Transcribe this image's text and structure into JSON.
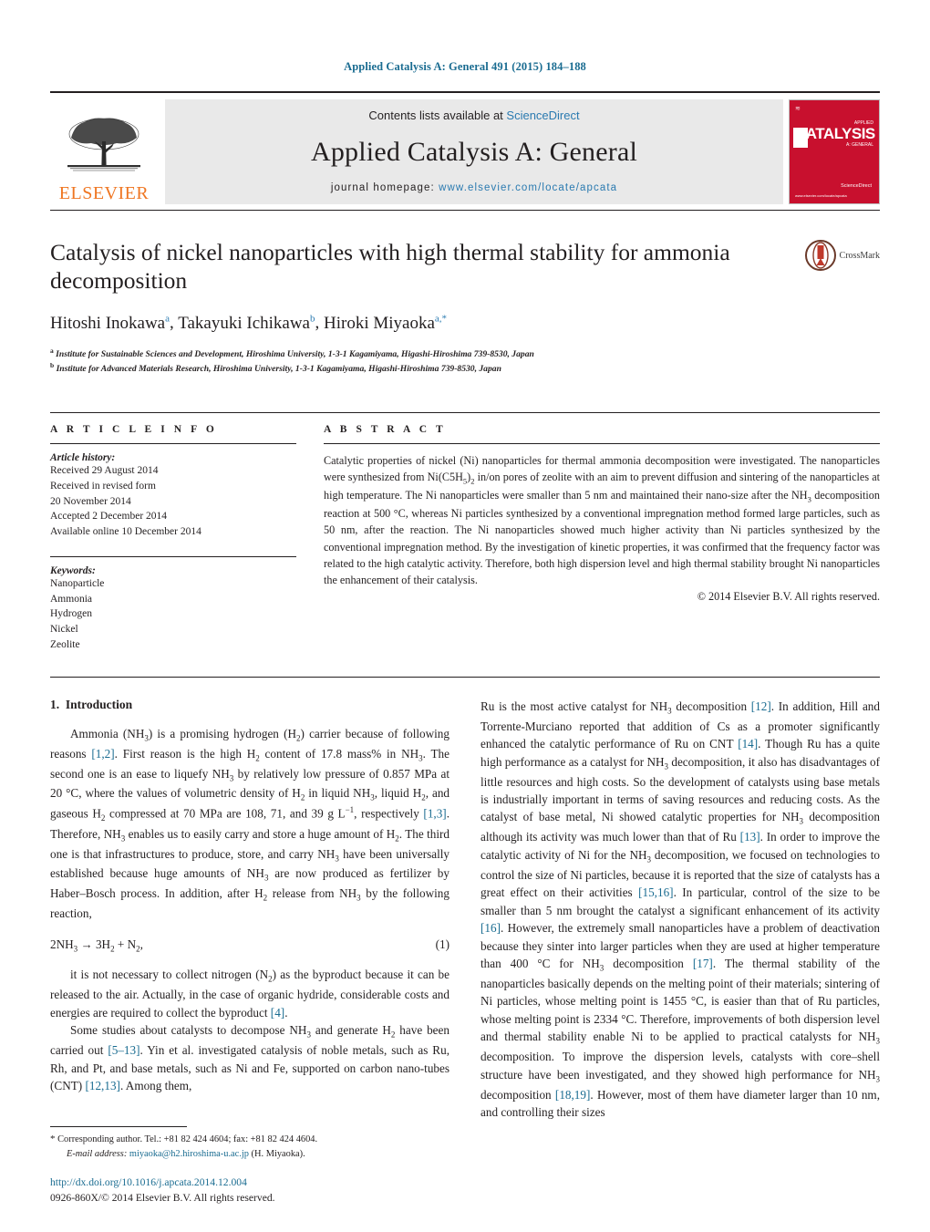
{
  "running_head": "Applied Catalysis A: General 491 (2015) 184–188",
  "masthead": {
    "publisher_name": "ELSEVIER",
    "contents_prefix": "Contents lists available at ",
    "contents_link": "ScienceDirect",
    "journal_name": "Applied Catalysis A: General",
    "homepage_label": "journal homepage: ",
    "homepage_url": "www.elsevier.com/locate/apcata",
    "cover": {
      "title": "CATALYSIS",
      "top_label": "APPLIED",
      "sub_label": "A: GENERAL",
      "brand": "ELSEVIER",
      "foot": "Available online at\nScienceDirect",
      "foot_small": "www.elsevier.com/locate/apcata"
    }
  },
  "article": {
    "title": "Catalysis of nickel nanoparticles with high thermal stability for ammonia decomposition",
    "authors": [
      {
        "name": "Hitoshi Inokawa",
        "sup": "a",
        "sep": ", "
      },
      {
        "name": "Takayuki Ichikawa",
        "sup": "b",
        "sep": ", "
      },
      {
        "name": "Hiroki Miyaoka",
        "sup": "a,",
        "star": "*",
        "sep": ""
      }
    ],
    "affiliations": [
      {
        "marker": "a",
        "text": "Institute for Sustainable Sciences and Development, Hiroshima University, 1-3-1 Kagamiyama, Higashi-Hiroshima 739-8530, Japan"
      },
      {
        "marker": "b",
        "text": "Institute for Advanced Materials Research, Hiroshima University, 1-3-1 Kagamiyama, Higashi-Hiroshima 739-8530, Japan"
      }
    ],
    "crossmark_label": "CrossMark"
  },
  "article_info": {
    "heading": "A R T I C L E   I N F O",
    "history_label": "Article history:",
    "history": [
      "Received 29 August 2014",
      "Received in revised form",
      "20 November 2014",
      "Accepted 2 December 2014",
      "Available online 10 December 2014"
    ],
    "keywords_label": "Keywords:",
    "keywords": [
      "Nanoparticle",
      "Ammonia",
      "Hydrogen",
      "Nickel",
      "Zeolite"
    ]
  },
  "abstract": {
    "heading": "A B S T R A C T",
    "paragraphs": [
      "Catalytic properties of nickel (Ni) nanoparticles for thermal ammonia decomposition were investigated. The nanoparticles were synthesized from Ni(C5H5)2 in/on pores of zeolite with an aim to prevent diffusion and sintering of the nanoparticles at high temperature. The Ni nanoparticles were smaller than 5 nm and maintained their nano-size after the NH3 decomposition reaction at 500 °C, whereas Ni particles synthesized by a conventional impregnation method formed large particles, such as 50 nm, after the reaction. The Ni nanoparticles showed much higher activity than Ni particles synthesized by the conventional impregnation method. By the investigation of kinetic properties, it was confirmed that the frequency factor was related to the high catalytic activity. Therefore, both high dispersion level and high thermal stability brought Ni nanoparticles the enhancement of their catalysis."
    ],
    "copyright": "© 2014 Elsevier B.V. All rights reserved."
  },
  "body": {
    "section_number": "1.",
    "section_title": "Introduction",
    "left_paragraphs": [
      "Ammonia (NH3) is a promising hydrogen (H2) carrier because of following reasons [1,2]. First reason is the high H2 content of 17.8 mass% in NH3. The second one is an ease to liquefy NH3 by relatively low pressure of 0.857 MPa at 20 °C, where the values of volumetric density of H2 in liquid NH3, liquid H2, and gaseous H2 compressed at 70 MPa are 108, 71, and 39 g L−1, respectively [1,3]. Therefore, NH3 enables us to easily carry and store a huge amount of H2. The third one is that infrastructures to produce, store, and carry NH3 have been universally established because huge amounts of NH3 are now produced as fertilizer by Haber–Bosch process. In addition, after H2 release from NH3 by the following reaction,",
      "it is not necessary to collect nitrogen (N2) as the byproduct because it can be released to the air. Actually, in the case of organic hydride, considerable costs and energies are required to collect the byproduct [4].",
      "Some studies about catalysts to decompose NH3 and generate H2 have been carried out [5–13]. Yin et al. investigated catalysis of noble metals, such as Ru, Rh, and Pt, and base metals, such as Ni and Fe, supported on carbon nano-tubes (CNT) [12,13]. Among them,"
    ],
    "equation": {
      "text": "2NH3 → 3H2 + N2,",
      "number": "(1)"
    },
    "right_paragraphs": [
      "Ru is the most active catalyst for NH3 decomposition [12]. In addition, Hill and Torrente-Murciano reported that addition of Cs as a promoter significantly enhanced the catalytic performance of Ru on CNT [14]. Though Ru has a quite high performance as a catalyst for NH3 decomposition, it also has disadvantages of little resources and high costs. So the development of catalysts using base metals is industrially important in terms of saving resources and reducing costs. As the catalyst of base metal, Ni showed catalytic properties for NH3 decomposition although its activity was much lower than that of Ru [13]. In order to improve the catalytic activity of Ni for the NH3 decomposition, we focused on technologies to control the size of Ni particles, because it is reported that the size of catalysts has a great effect on their activities [15,16]. In particular, control of the size to be smaller than 5 nm brought the catalyst a significant enhancement of its activity [16]. However, the extremely small nanoparticles have a problem of deactivation because they sinter into larger particles when they are used at higher temperature than 400 °C for NH3 decomposition [17]. The thermal stability of the nanoparticles basically depends on the melting point of their materials; sintering of Ni particles, whose melting point is 1455 °C, is easier than that of Ru particles, whose melting point is 2334 °C. Therefore, improvements of both dispersion level and thermal stability enable Ni to be applied to practical catalysts for NH3 decomposition. To improve the dispersion levels, catalysts with core–shell structure have been investigated, and they showed high performance for NH3 decomposition [18,19]. However, most of them have diameter larger than 10 nm, and controlling their sizes"
    ]
  },
  "footer": {
    "corresponding_star": "*",
    "corresponding_text": "Corresponding author. Tel.: +81 82 424 4604; fax: +81 82 424 4604.",
    "email_label": "E-mail address:",
    "email": "miyaoka@h2.hiroshima-u.ac.jp",
    "email_suffix": " (H. Miyaoka).",
    "doi": "http://dx.doi.org/10.1016/j.apcata.2014.12.004",
    "issn": "0926-860X/© 2014 Elsevier B.V. All rights reserved."
  },
  "colors": {
    "link": "#1a6c91",
    "accent_orange": "#ef7622",
    "cover_red": "#c8102e",
    "band_gray": "#e9e9e9"
  }
}
